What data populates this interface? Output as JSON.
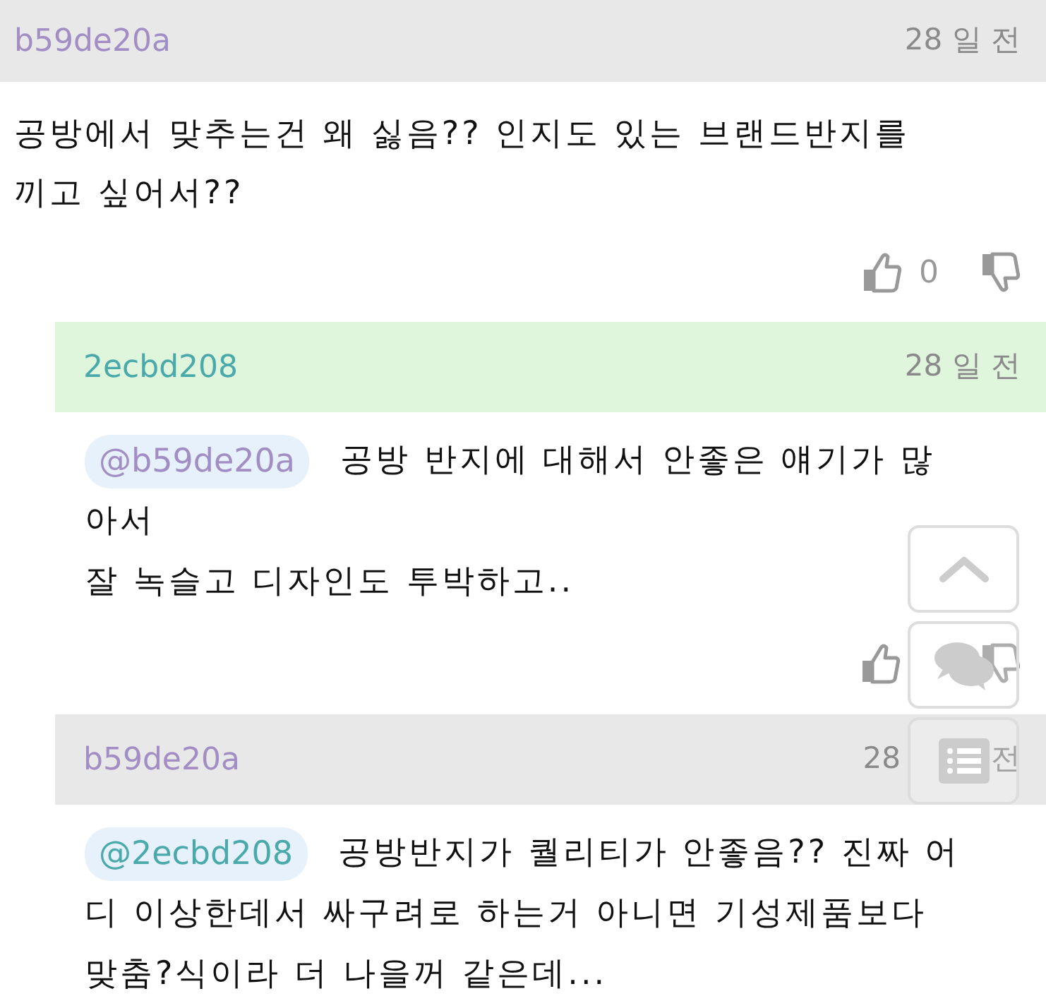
{
  "comments": [
    {
      "user": "b59de20a",
      "color": "#a28ec4",
      "time": [
        "28 일 전"
      ],
      "reply": false,
      "highlighted": false,
      "lines": [
        "공방에서 맞추는건 왜 싫음?? 인지도 있는 브랜드반지를",
        "끼고 싶어서??"
      ],
      "likes": "0"
    },
    {
      "user": "2ecbd208",
      "color": "#4aa9ab",
      "time": [
        "28 일 전"
      ],
      "reply": true,
      "highlighted": true,
      "mention": {
        "text": "@b59de20a",
        "color": "#a28ec4"
      },
      "lines": [
        "공방 반지에 대해서 안좋은 얘기가 많",
        "아서",
        "잘 녹슬고 디자인도 투박하고.."
      ]
    },
    {
      "user": "b59de20a",
      "color": "#a28ec4",
      "time": [
        "28",
        "전"
      ],
      "reply": true,
      "highlighted": false,
      "mention": {
        "text": "@2ecbd208",
        "color": "#4aa9ab"
      },
      "lines": [
        "공방반지가 퀄리티가 안좋음?? 진짜 어",
        "디 이상한데서 싸구려로 하는거 아니면 기성제품보다",
        "맞춤?식이라 더 나을꺼 같은데..."
      ]
    }
  ],
  "floating_buttons": [
    {
      "kind": "up"
    },
    {
      "kind": "chat"
    },
    {
      "kind": "list"
    }
  ]
}
